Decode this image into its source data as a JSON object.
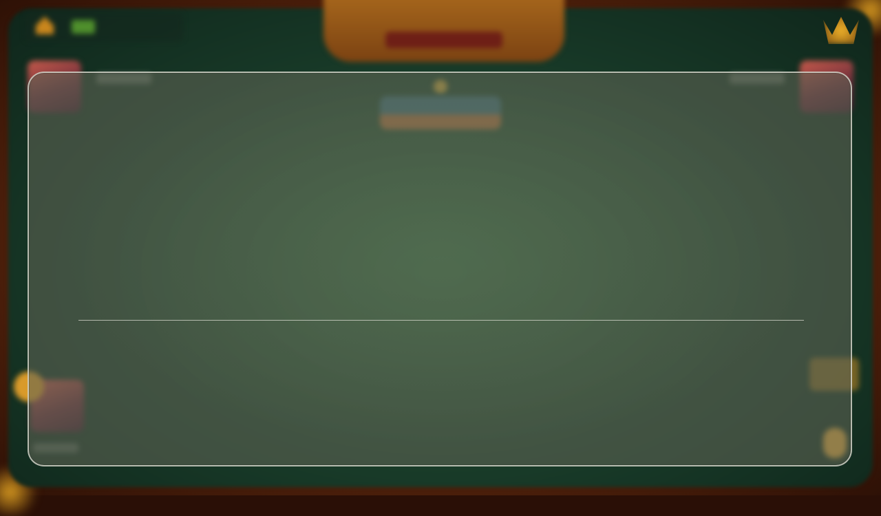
{
  "hud": {
    "top_left_text": "",
    "top_center": {
      "left_label": "",
      "right_label": ""
    }
  },
  "players": [
    {
      "position": "top-left",
      "name": ""
    },
    {
      "position": "top-right",
      "name": ""
    },
    {
      "position": "bottom-left",
      "name": ""
    }
  ],
  "dialog": {
    "state": "blank"
  },
  "colors": {
    "felt": "#2f5a3a",
    "frame": "#7a3a12",
    "gold": "#c9861d",
    "dialog_border": "#e1e1d7"
  },
  "icons": [
    "home-icon",
    "cash-icon",
    "crown-icon",
    "coin-icon",
    "star-icon"
  ]
}
